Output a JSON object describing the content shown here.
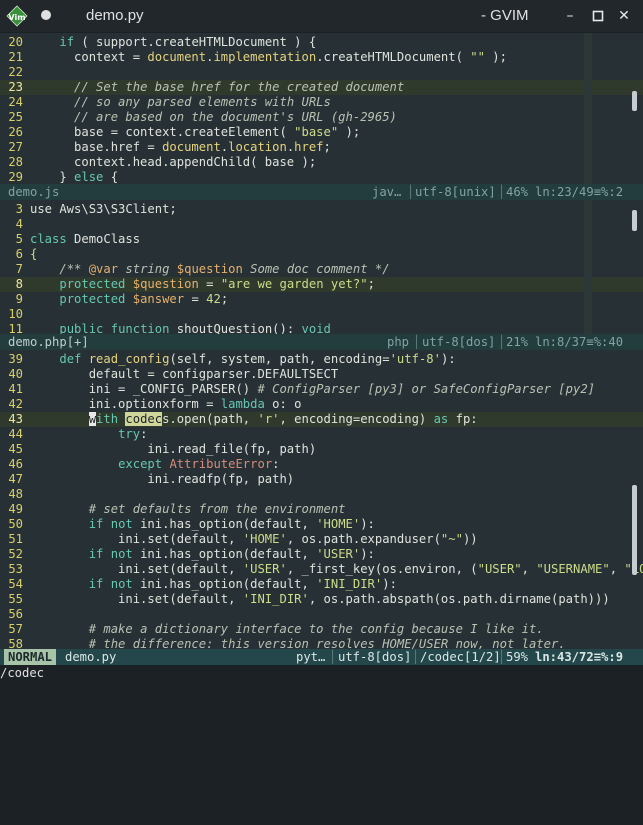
{
  "window": {
    "title": "demo.py",
    "app_name": "- GVIM",
    "vim_logo_text": "Vim"
  },
  "pane1": {
    "lines": [
      {
        "n": "20",
        "segs": [
          [
            "    "
          ],
          [
            "if",
            "kw"
          ],
          [
            " ( support.createHTMLDocument ) {"
          ]
        ]
      },
      {
        "n": "21",
        "segs": [
          [
            "      context = "
          ],
          [
            "document",
            "fn"
          ],
          [
            "."
          ],
          [
            "implementation",
            "fn"
          ],
          [
            ".createHTMLDocument( "
          ],
          [
            "\"\"",
            "str"
          ],
          [
            " );"
          ]
        ]
      },
      {
        "n": "22",
        "segs": [
          [
            ""
          ]
        ]
      },
      {
        "n": "23",
        "cur": true,
        "segs": [
          [
            "      "
          ],
          [
            "// Set the base href for the created document",
            "cm"
          ]
        ]
      },
      {
        "n": "24",
        "segs": [
          [
            "      "
          ],
          [
            "// so any parsed elements with URLs",
            "cm"
          ]
        ]
      },
      {
        "n": "25",
        "segs": [
          [
            "      "
          ],
          [
            "// are based on the document's URL (gh-2965)",
            "cm"
          ]
        ]
      },
      {
        "n": "26",
        "segs": [
          [
            "      base = context.createElement( "
          ],
          [
            "\"base\"",
            "str"
          ],
          [
            " );"
          ]
        ]
      },
      {
        "n": "27",
        "segs": [
          [
            "      base.href = "
          ],
          [
            "document",
            "fn"
          ],
          [
            "."
          ],
          [
            "location",
            "fn"
          ],
          [
            "."
          ],
          [
            "href",
            "fn"
          ],
          [
            ";"
          ]
        ]
      },
      {
        "n": "28",
        "segs": [
          [
            "      context.head.appendChild( base );"
          ]
        ]
      },
      {
        "n": "29",
        "segs": [
          [
            "    } "
          ],
          [
            "else",
            "kw"
          ],
          [
            " {"
          ]
        ]
      }
    ],
    "status": {
      "file": "demo.js",
      "filetype": "jav…",
      "encoding": "utf-8[unix]",
      "percent": "46%",
      "position": "ln:23/49≡%:2"
    }
  },
  "pane2": {
    "lines": [
      {
        "n": "3",
        "segs": [
          [
            "use Aws\\S3\\S3Client;"
          ]
        ]
      },
      {
        "n": "4",
        "segs": [
          [
            ""
          ]
        ]
      },
      {
        "n": "5",
        "segs": [
          [
            "class",
            "kw"
          ],
          [
            " DemoClass"
          ]
        ]
      },
      {
        "n": "6",
        "segs": [
          [
            "{",
            "str"
          ]
        ]
      },
      {
        "n": "7",
        "segs": [
          [
            "    "
          ],
          [
            "/** ",
            "cm"
          ],
          [
            "@var",
            "var"
          ],
          [
            " string ",
            "cm"
          ],
          [
            "$question",
            "var"
          ],
          [
            " Some doc comment */",
            "cm"
          ]
        ]
      },
      {
        "n": "8",
        "cur": true,
        "segs": [
          [
            "    "
          ],
          [
            "protected",
            "kw"
          ],
          [
            " "
          ],
          [
            "$question",
            "var"
          ],
          [
            " = "
          ],
          [
            "\"are we garden yet?\"",
            "str"
          ],
          [
            ";"
          ]
        ]
      },
      {
        "n": "9",
        "segs": [
          [
            "    "
          ],
          [
            "protected",
            "kw"
          ],
          [
            " "
          ],
          [
            "$answer",
            "var"
          ],
          [
            " = "
          ],
          [
            "42",
            "str"
          ],
          [
            ";"
          ]
        ]
      },
      {
        "n": "10",
        "segs": [
          [
            ""
          ]
        ]
      },
      {
        "n": "11",
        "segs": [
          [
            "    "
          ],
          [
            "public",
            "kw"
          ],
          [
            " "
          ],
          [
            "function",
            "kw"
          ],
          [
            " shoutQuestion(): "
          ],
          [
            "void",
            "kw"
          ]
        ]
      }
    ],
    "status": {
      "file": "demo.php[+]",
      "filetype": "php",
      "encoding": "utf-8[dos]",
      "percent": "21%",
      "position": "ln:8/37≡%:40"
    }
  },
  "pane3": {
    "lines": [
      {
        "n": "39",
        "segs": [
          [
            "    "
          ],
          [
            "def",
            "kw"
          ],
          [
            " "
          ],
          [
            "read_config",
            "fn"
          ],
          [
            "(self, system, path, encoding="
          ],
          [
            "'utf-8'",
            "str"
          ],
          [
            "):"
          ]
        ]
      },
      {
        "n": "40",
        "segs": [
          [
            "        default = configparser.DEFAULTSECT"
          ]
        ]
      },
      {
        "n": "41",
        "segs": [
          [
            "        ini = _CONFIG_PARSER() "
          ],
          [
            "# ConfigParser [py3] or SafeConfigParser [py2]",
            "cm"
          ]
        ]
      },
      {
        "n": "42",
        "segs": [
          [
            "        ini.optionxform = "
          ],
          [
            "lambda",
            "kw"
          ],
          [
            " o: o"
          ]
        ]
      },
      {
        "n": "43",
        "cur": true,
        "segs": [
          [
            "        "
          ],
          [
            "w",
            "cursor"
          ],
          [
            "ith",
            "kw"
          ],
          [
            " "
          ],
          [
            "codec",
            "hlw"
          ],
          [
            "s.open(path, "
          ],
          [
            "'r'",
            "str"
          ],
          [
            ", encoding=encoding) "
          ],
          [
            "as",
            "kw"
          ],
          [
            " fp:"
          ]
        ]
      },
      {
        "n": "44",
        "segs": [
          [
            "            "
          ],
          [
            "try",
            "kw"
          ],
          [
            ":"
          ]
        ]
      },
      {
        "n": "45",
        "segs": [
          [
            "                ini.read_file(fp, path)"
          ]
        ]
      },
      {
        "n": "46",
        "segs": [
          [
            "            "
          ],
          [
            "except",
            "kw"
          ],
          [
            " "
          ],
          [
            "AttributeError",
            "ex"
          ],
          [
            ":"
          ]
        ]
      },
      {
        "n": "47",
        "segs": [
          [
            "                ini.readfp(fp, path)"
          ]
        ]
      },
      {
        "n": "48",
        "segs": [
          [
            ""
          ]
        ]
      },
      {
        "n": "49",
        "segs": [
          [
            "        "
          ],
          [
            "# set defaults from the environment",
            "cm"
          ]
        ]
      },
      {
        "n": "50",
        "segs": [
          [
            "        "
          ],
          [
            "if",
            "kw"
          ],
          [
            " "
          ],
          [
            "not",
            "kw"
          ],
          [
            " ini.has_option(default, "
          ],
          [
            "'HOME'",
            "str"
          ],
          [
            "):"
          ]
        ]
      },
      {
        "n": "51",
        "segs": [
          [
            "            ini.set(default, "
          ],
          [
            "'HOME'",
            "str"
          ],
          [
            ", os.path.expanduser("
          ],
          [
            "\"~\"",
            "str"
          ],
          [
            "))"
          ]
        ]
      },
      {
        "n": "52",
        "segs": [
          [
            "        "
          ],
          [
            "if",
            "kw"
          ],
          [
            " "
          ],
          [
            "not",
            "kw"
          ],
          [
            " ini.has_option(default, "
          ],
          [
            "'USER'",
            "str"
          ],
          [
            "):"
          ]
        ]
      },
      {
        "n": "53",
        "segs": [
          [
            "            ini.set(default, "
          ],
          [
            "'USER'",
            "str"
          ],
          [
            ", _first_key(os.environ, ("
          ],
          [
            "\"USER\"",
            "str"
          ],
          [
            ", "
          ],
          [
            "\"USERNAME\"",
            "str"
          ],
          [
            ", "
          ],
          [
            "\"LOG",
            "str"
          ]
        ]
      },
      {
        "n": "54",
        "segs": [
          [
            "        "
          ],
          [
            "if",
            "kw"
          ],
          [
            " "
          ],
          [
            "not",
            "kw"
          ],
          [
            " ini.has_option(default, "
          ],
          [
            "'INI_DIR'",
            "str"
          ],
          [
            "):"
          ]
        ]
      },
      {
        "n": "55",
        "segs": [
          [
            "            ini.set(default, "
          ],
          [
            "'INI_DIR'",
            "str"
          ],
          [
            ", os.path.abspath(os.path.dirname(path)))"
          ]
        ]
      },
      {
        "n": "56",
        "segs": [
          [
            ""
          ]
        ]
      },
      {
        "n": "57",
        "segs": [
          [
            "        "
          ],
          [
            "# make a dictionary interface to the config because I like it.",
            "cm"
          ]
        ]
      },
      {
        "n": "58",
        "segs": [
          [
            "        "
          ],
          [
            "# the difference: this version resolves HOME/USER now, not later.",
            "cm"
          ]
        ]
      }
    ],
    "status": {
      "mode": "NORMAL",
      "file": "demo.py",
      "filetype": "pyt…",
      "encoding": "utf-8[dos]",
      "search": "/codec[1/2]",
      "percent": "59%",
      "position": "ln:43/72≡%:9"
    }
  },
  "cmdline": "/codec",
  "colors": {
    "background": "#263035",
    "statusline": "#233c3e",
    "cursorline": "#2f3a2c",
    "keyword": "#66c7b3",
    "string": "#cddc8a",
    "linenumber": "#d9cf6a"
  }
}
